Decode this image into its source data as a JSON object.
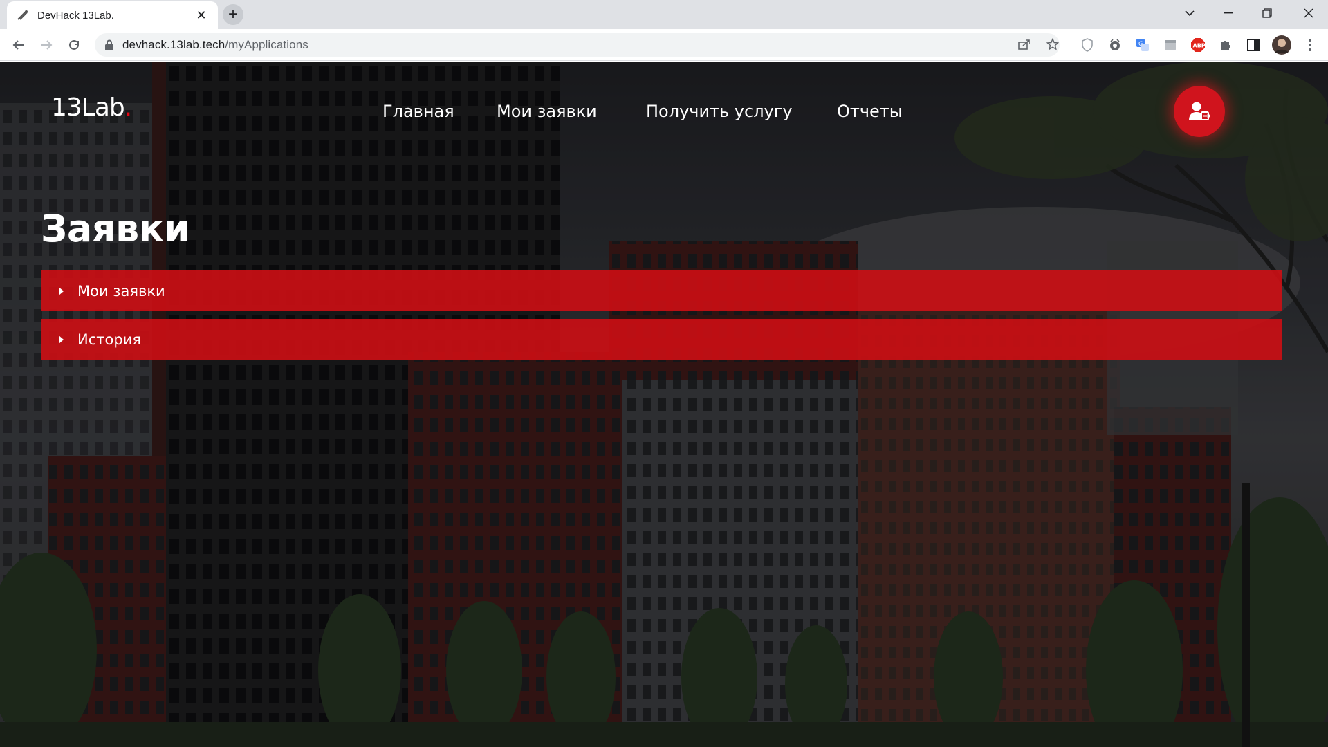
{
  "browser": {
    "tab_title": "DevHack 13Lab.",
    "url_host": "devhack.13lab.tech",
    "url_path": "/myApplications"
  },
  "site": {
    "logo_text": "13Lab",
    "logo_dot": ".",
    "nav": {
      "home": "Главная",
      "my_requests": "Мои заявки",
      "get_service": "Получить услугу",
      "reports": "Отчеты"
    },
    "page_title": "Заявки",
    "accordion": [
      {
        "label": "Мои заявки"
      },
      {
        "label": "История"
      }
    ]
  },
  "colors": {
    "accent": "#d0141d",
    "accordion_bg": "#cd0e14",
    "logo_dot": "#e30613"
  },
  "icons": {
    "user_button": "user-logout-icon"
  }
}
